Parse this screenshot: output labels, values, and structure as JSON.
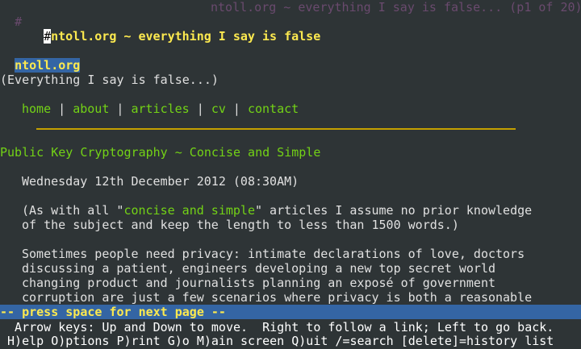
{
  "topbar": {
    "hash": "#",
    "title": "ntoll.org ~ everything I say is false... (p1 of 20)"
  },
  "header": {
    "cursor_char": "#",
    "title": "ntoll.org ~ everything I say is false"
  },
  "site_name_link": "ntoll.org",
  "tagline": "(Everything I say is false...)",
  "nav": {
    "home": "home",
    "about": "about",
    "articles": "articles",
    "cv": "cv",
    "contact": "contact",
    "separator": "|"
  },
  "article": {
    "title": "Public Key Cryptography ~ Concise and Simple",
    "date": "Wednesday 12th December 2012 (08:30AM)",
    "intro_prefix": "(As with all \"",
    "intro_link": "concise and simple",
    "intro_suffix": "\" articles I assume no prior knowledge",
    "intro_line2": "of the subject and keep the length to less than 1500 words.)",
    "para_lines": [
      "Sometimes people need privacy: intimate declarations of love, doctors",
      "discussing a patient, engineers developing a new top secret world",
      "changing product and journalists planning an exposé of government",
      "corruption are just a few scenarios where privacy is both a reasonable"
    ]
  },
  "status": "-- press space for next page --",
  "help": {
    "line1": "  Arrow keys: Up and Down to move.  Right to follow a link; Left to go back.",
    "line2": " H)elp O)ptions P)rint G)o M)ain screen Q)uit /=search [delete]=history list"
  }
}
